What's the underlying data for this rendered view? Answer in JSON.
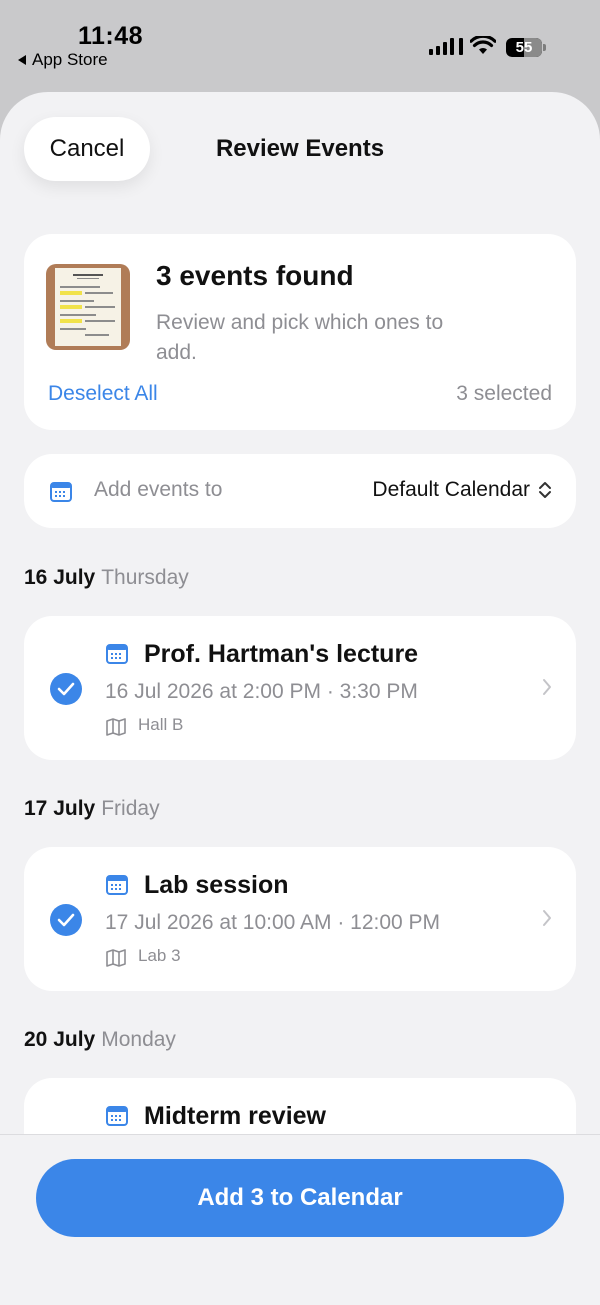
{
  "status_bar": {
    "time": "11:48",
    "back_label": "App Store",
    "battery": "55"
  },
  "header": {
    "cancel_label": "Cancel",
    "title": "Review Events"
  },
  "summary": {
    "title": "3 events found",
    "subtitle": "Review and pick which ones to add.",
    "deselect_label": "Deselect All",
    "selected_count": "3 selected"
  },
  "calendar_picker": {
    "label": "Add events to",
    "value": "Default Calendar"
  },
  "days": [
    {
      "date": "16 July",
      "weekday": "Thursday",
      "event": {
        "title": "Prof. Hartman's lecture",
        "time": "16 Jul 2026 at 2:00 PM · 3:30 PM",
        "location": "Hall B",
        "checked": true
      }
    },
    {
      "date": "17 July",
      "weekday": "Friday",
      "event": {
        "title": "Lab session",
        "time": "17 Jul 2026 at 10:00 AM · 12:00 PM",
        "location": "Lab 3",
        "checked": true
      }
    },
    {
      "date": "20 July",
      "weekday": "Monday",
      "event": {
        "title": "Midterm review",
        "checked": true
      }
    }
  ],
  "footer": {
    "add_label": "Add 3 to Calendar"
  },
  "colors": {
    "accent": "#3b86e8",
    "background": "#f2f2f4",
    "muted_text": "#8e8e93"
  },
  "icons": [
    "calendar-icon",
    "map-icon",
    "checkmark-icon",
    "chevron-right-icon",
    "updown-chevron-icon",
    "wifi-icon",
    "signal-icon",
    "battery-icon"
  ]
}
